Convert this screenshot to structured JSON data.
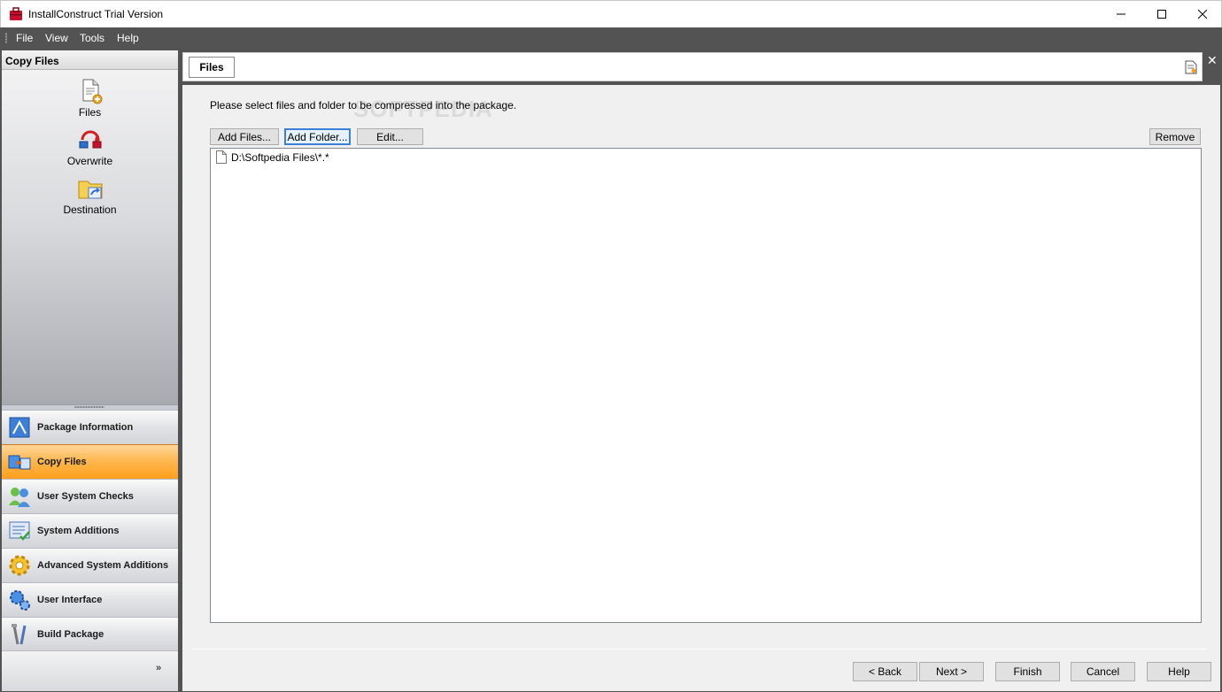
{
  "window": {
    "title": "InstallConstruct Trial Version",
    "app_icon": "toolbox-icon",
    "controls": {
      "minimize": "minimize-icon",
      "maximize": "maximize-icon",
      "close": "close-icon"
    }
  },
  "menu": {
    "items": [
      "File",
      "View",
      "Tools",
      "Help"
    ]
  },
  "sidebar": {
    "header": "Copy Files",
    "tools": [
      {
        "label": "Files",
        "icon": "file-add-icon"
      },
      {
        "label": "Overwrite",
        "icon": "overwrite-icon"
      },
      {
        "label": "Destination",
        "icon": "folder-destination-icon"
      }
    ],
    "nav": [
      {
        "label": "Package Information",
        "icon": "package-info-icon",
        "active": false
      },
      {
        "label": "Copy Files",
        "icon": "copy-files-icon",
        "active": true
      },
      {
        "label": "User System Checks",
        "icon": "users-check-icon",
        "active": false
      },
      {
        "label": "System Additions",
        "icon": "system-additions-icon",
        "active": false
      },
      {
        "label": "Advanced System Additions",
        "icon": "gear-icon",
        "active": false
      },
      {
        "label": "User Interface",
        "icon": "ui-gears-icon",
        "active": false
      },
      {
        "label": "Build Package",
        "icon": "build-tools-icon",
        "active": false
      }
    ],
    "more_glyph": "»"
  },
  "tabs": {
    "active": "Files",
    "close_glyph": "✕"
  },
  "content": {
    "instruction": "Please select files and folder to be compressed into the package.",
    "buttons": {
      "add_files": "Add Files...",
      "add_folder": "Add Folder...",
      "edit": "Edit...",
      "remove": "Remove"
    },
    "files": [
      {
        "path": "D:\\Softpedia Files\\*.*",
        "icon": "file-icon"
      }
    ],
    "watermark": "SOFTPEDIA"
  },
  "footer": {
    "back": "< Back",
    "next": "Next >",
    "finish": "Finish",
    "cancel": "Cancel",
    "help": "Help"
  },
  "colors": {
    "menubar_bg": "#535353",
    "active_nav": "#ffb54b",
    "focus_border": "#3b7fd9"
  }
}
